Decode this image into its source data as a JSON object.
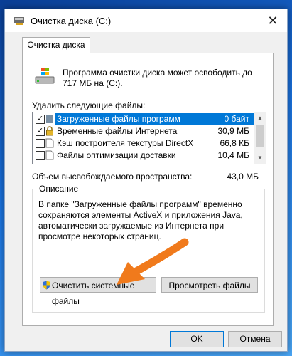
{
  "window": {
    "title": "Очистка диска  (C:)",
    "close_glyph": "✕"
  },
  "tab": {
    "label": "Очистка диска"
  },
  "intro_text": "Программа очистки диска может освободить до 717 МБ на  (C:).",
  "list_label": "Удалить следующие файлы:",
  "files": [
    {
      "name": "Загруженные файлы программ",
      "size": "0 байт",
      "checked": true,
      "selected": true,
      "icon": "folder-icon"
    },
    {
      "name": "Временные файлы Интернета",
      "size": "30,9 МБ",
      "checked": true,
      "selected": false,
      "icon": "lock-icon"
    },
    {
      "name": "Кэш построителя текстуры DirectX",
      "size": "66,8 КБ",
      "checked": false,
      "selected": false,
      "icon": "document-icon"
    },
    {
      "name": "Файлы оптимизации доставки",
      "size": "10,4 МБ",
      "checked": false,
      "selected": false,
      "icon": "document-icon"
    }
  ],
  "checkbox_glyph": "✓",
  "total": {
    "label": "Объем высвобождаемого пространства:",
    "value": "43,0 МБ"
  },
  "description": {
    "title": "Описание",
    "text": "В папке \"Загруженные файлы программ\" временно сохраняются элементы ActiveX и приложения Java, автоматически загружаемые из Интернета при просмотре некоторых страниц."
  },
  "buttons": {
    "cleanup_system": "Очистить системные файлы",
    "view_files": "Просмотреть файлы",
    "ok": "OK",
    "cancel": "Отмена"
  },
  "scrollbar": {
    "up_glyph": "▲",
    "down_glyph": "▼"
  },
  "colors": {
    "selection": "#0078d7",
    "arrow": "#f07a1c",
    "desktop": "#1a73e0"
  }
}
